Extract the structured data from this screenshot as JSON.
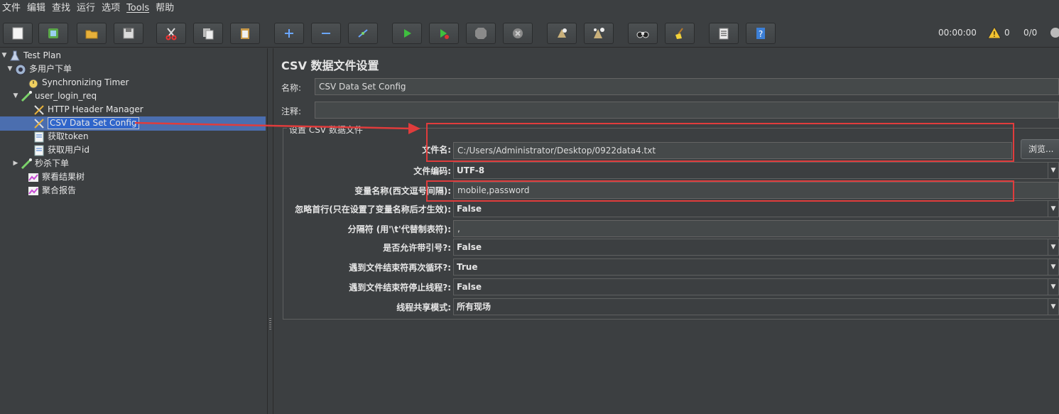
{
  "menu": [
    "文件",
    "编辑",
    "查找",
    "运行",
    "选项",
    "Tools",
    "帮助"
  ],
  "status": {
    "timer": "00:00:00",
    "warnings": "0",
    "threads": "0/0"
  },
  "tree": [
    {
      "label": "Test Plan",
      "icon": "flask-icon",
      "toggle": "▼"
    },
    {
      "label": "多用户下单",
      "icon": "gear-icon",
      "toggle": "▼"
    },
    {
      "label": "Synchronizing Timer",
      "icon": "stopwatch-icon",
      "toggle": ""
    },
    {
      "label": "user_login_req",
      "icon": "pipette-icon",
      "toggle": "▼"
    },
    {
      "label": "HTTP Header Manager",
      "icon": "wrench-icon",
      "toggle": ""
    },
    {
      "label": "CSV Data Set Config",
      "icon": "wrench-icon",
      "toggle": ""
    },
    {
      "label": "获取token",
      "icon": "script-icon",
      "toggle": ""
    },
    {
      "label": "获取用户id",
      "icon": "script-icon",
      "toggle": ""
    },
    {
      "label": "秒杀下单",
      "icon": "pipette-icon",
      "toggle": "▶"
    },
    {
      "label": "察看结果树",
      "icon": "graph-icon",
      "toggle": ""
    },
    {
      "label": "聚合报告",
      "icon": "graph-icon",
      "toggle": ""
    }
  ],
  "panel": {
    "title": "CSV 数据文件设置",
    "name_label": "名称:",
    "name_value": "CSV Data Set Config",
    "comment_label": "注释:",
    "comment_value": "",
    "group_title": "设置 CSV 数据文件",
    "browse_label": "浏览...",
    "rows": [
      {
        "label": "文件名:",
        "value": "C:/Users/Administrator/Desktop/0922data4.txt",
        "kind": "text"
      },
      {
        "label": "文件编码:",
        "value": "UTF-8",
        "kind": "combo"
      },
      {
        "label": "变量名称(西文逗号间隔):",
        "value": "mobile,password",
        "kind": "text"
      },
      {
        "label": "忽略首行(只在设置了变量名称后才生效):",
        "value": "False",
        "kind": "combo"
      },
      {
        "label": "分隔符 (用'\\t'代替制表符):",
        "value": ",",
        "kind": "text"
      },
      {
        "label": "是否允许带引号?:",
        "value": "False",
        "kind": "combo"
      },
      {
        "label": "遇到文件结束符再次循环?:",
        "value": "True",
        "kind": "combo"
      },
      {
        "label": "遇到文件结束符停止线程?:",
        "value": "False",
        "kind": "combo"
      },
      {
        "label": "线程共享模式:",
        "value": "所有现场",
        "kind": "combo"
      }
    ]
  },
  "colors": {
    "background": "#3c3f41",
    "selection": "#4b6eaf",
    "annotation": "#e03c3c"
  }
}
